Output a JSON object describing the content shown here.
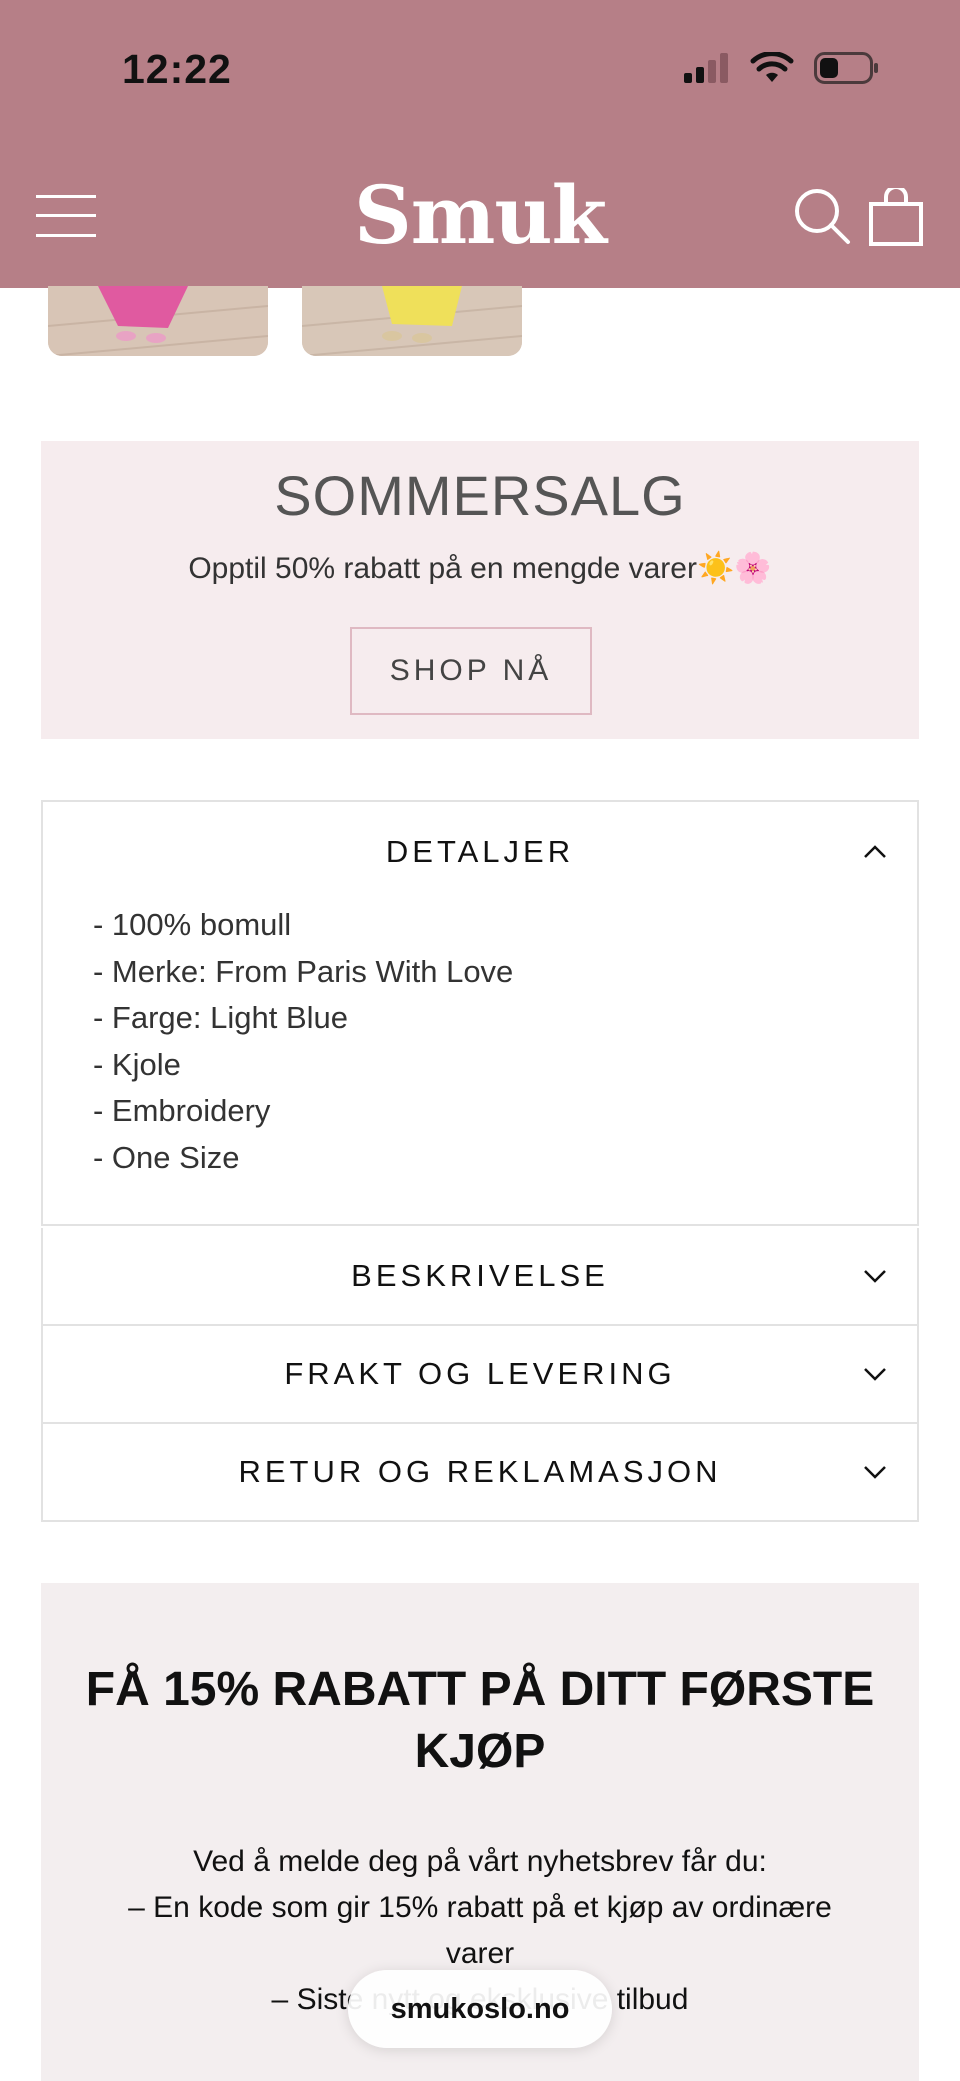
{
  "status_bar": {
    "time": "12:22"
  },
  "header": {
    "logo": "Smuk",
    "background_color": "#b67f87"
  },
  "sale_banner": {
    "title": "SOMMERSALG",
    "subtitle": "Opptil 50% rabatt på en mengde varer☀️🌸",
    "button_label": "SHOP NÅ",
    "background_color": "#f6ecee"
  },
  "accordion": {
    "details": {
      "title": "DETALJER",
      "items": [
        "- 100% bomull",
        "- Merke: From Paris With Love",
        "- Farge: Light Blue",
        "- Kjole",
        "- Embroidery",
        "- One Size"
      ]
    },
    "description": {
      "title": "BESKRIVELSE"
    },
    "shipping": {
      "title": "FRAKT OG LEVERING"
    },
    "returns": {
      "title": "RETUR OG REKLAMASJON"
    }
  },
  "newsletter": {
    "title": "FÅ 15% RABATT PÅ DITT FØRSTE KJØP",
    "intro": "Ved å melde deg på vårt nyhetsbrev får du:",
    "point1": "– En kode som gir 15% rabatt på et kjøp av ordinære varer",
    "point2": "– Siste nytt og eksklusive tilbud"
  },
  "browser": {
    "url": "smukoslo.no"
  }
}
